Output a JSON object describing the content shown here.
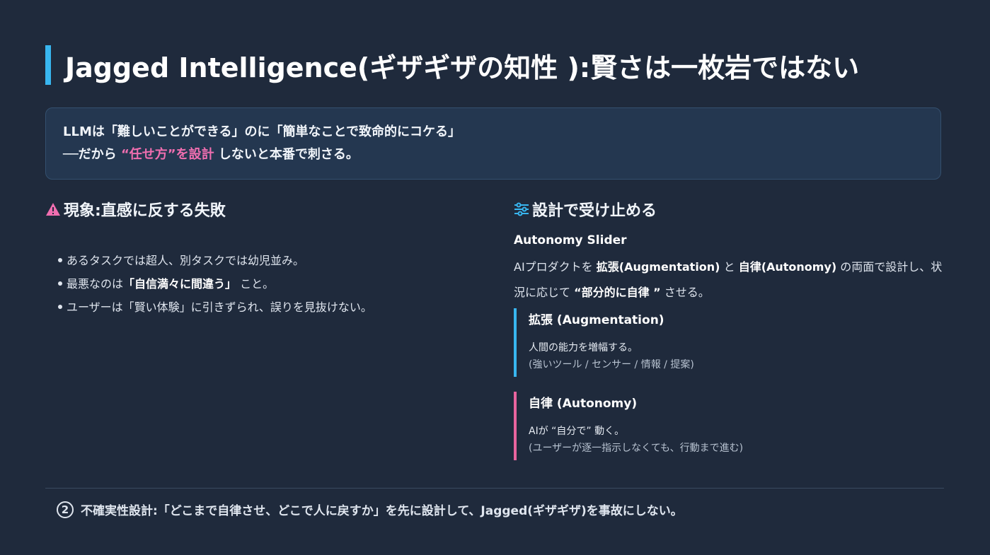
{
  "title": "Jagged Intelligence(ギザギザの知性 ):賢さは一枚岩ではない",
  "callout": {
    "line1": "LLMは「難しいことができる」のに「簡単なことで致命的にコケる」",
    "line2_prefix": "──だから ",
    "line2_highlight": "“任せ方”を設計",
    "line2_suffix": " しないと本番で刺さる。"
  },
  "left": {
    "heading": "現象:直感に反する失敗",
    "bullets": [
      {
        "pre": "あるタスクでは超人、別タスクでは幼児並み。",
        "bold": "",
        "post": ""
      },
      {
        "pre": "最悪なのは",
        "bold": "「自信満々に間違う」",
        "post": " こと。"
      },
      {
        "pre": "ユーザーは「賢い体験」に引きずられ、誤りを見抜けない。",
        "bold": "",
        "post": ""
      }
    ]
  },
  "right": {
    "heading": "設計で受け止める",
    "slider_title": "Autonomy Slider",
    "desc": {
      "p1": "AIプロダクトを ",
      "b1": "拡張(Augmentation)",
      "p2": " と ",
      "b2": "自律(Autonomy)",
      "p3": " の両面で設計し、状況に応じて ",
      "hl": "“部分的に自律 ”",
      "p4": " させる。"
    },
    "cards": {
      "augmentation": {
        "title": "拡張 (Augmentation)",
        "line1": "人間の能力を増幅する。",
        "line2": "(強いツール / センサー / 情報 / 提案)"
      },
      "autonomy": {
        "title": "自律 (Autonomy)",
        "line1": "AIが “自分で” 動く。",
        "line2": "(ユーザーが逐一指示しなくても、行動まで進む)"
      }
    }
  },
  "footer": {
    "number": "2",
    "text": "不確実性設計:「どこまで自律させ、どこで人に戻すか」を先に設計して、Jagged(ギザギザ)を事故にしない。"
  },
  "colors": {
    "background": "#1f2a3c",
    "accent_blue": "#38b6f0",
    "accent_pink": "#e8649e"
  },
  "icons": {
    "left_heading": "warning-icon",
    "right_heading": "sliders-icon"
  }
}
